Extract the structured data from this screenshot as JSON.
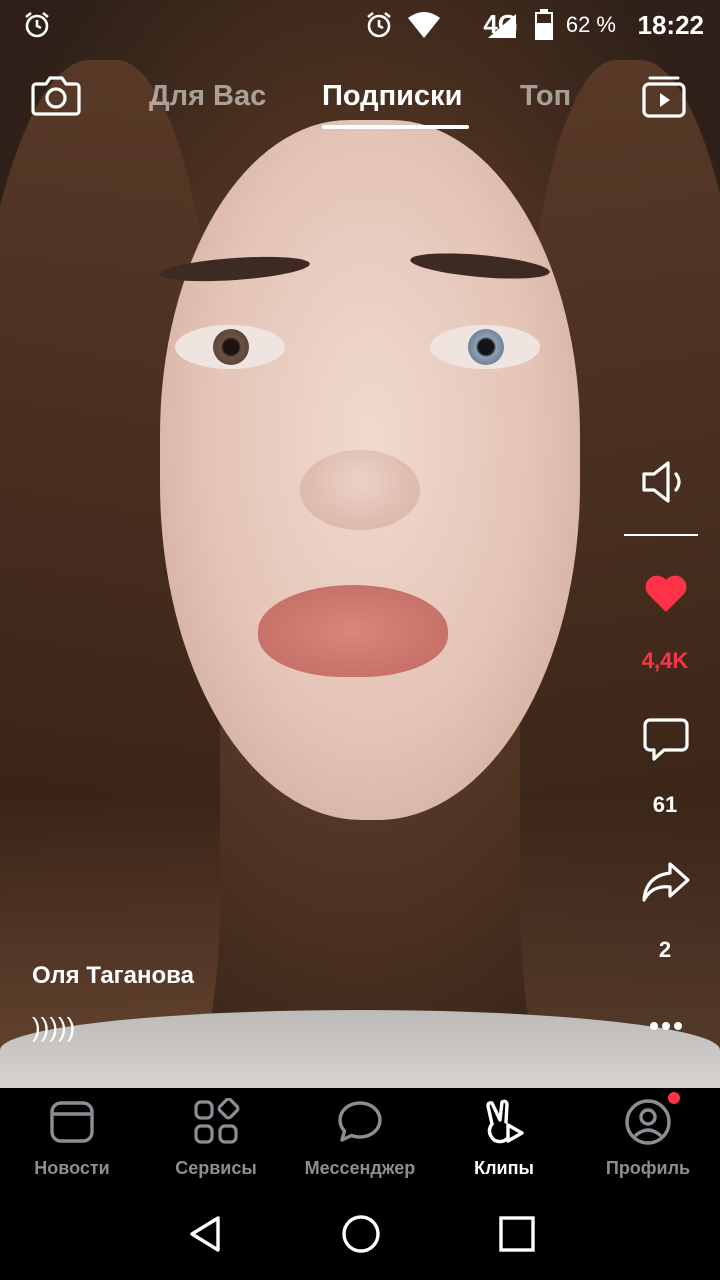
{
  "status_bar": {
    "network": "4G",
    "battery": "62 %",
    "time": "18:22",
    "icons": [
      "alarm-icon",
      "alarm-icon",
      "wifi-icon",
      "signal-icon",
      "battery-icon"
    ]
  },
  "top_tabs": {
    "camera_icon": "camera-icon",
    "tabs": [
      {
        "label": "Для Вас",
        "active": false
      },
      {
        "label": "Подписки",
        "active": true
      },
      {
        "label": "Топ",
        "active": false
      }
    ],
    "right_icon": "clips-library-icon"
  },
  "actions": {
    "sound_icon": "volume-icon",
    "likes": "4,4K",
    "comments": "61",
    "shares": "2",
    "more_icon": "more-icon",
    "like_color": "#ff3347"
  },
  "clip": {
    "author": "Оля Таганова",
    "caption": ")))))"
  },
  "tab_bar": {
    "items": [
      {
        "label": "Новости",
        "icon": "news-icon"
      },
      {
        "label": "Сервисы",
        "icon": "services-icon"
      },
      {
        "label": "Мессенджер",
        "icon": "messenger-icon"
      },
      {
        "label": "Клипы",
        "icon": "clips-icon",
        "active": true
      },
      {
        "label": "Профиль",
        "icon": "profile-icon",
        "badge": true
      }
    ]
  },
  "system_nav": [
    "back-icon",
    "home-icon",
    "recents-icon"
  ]
}
